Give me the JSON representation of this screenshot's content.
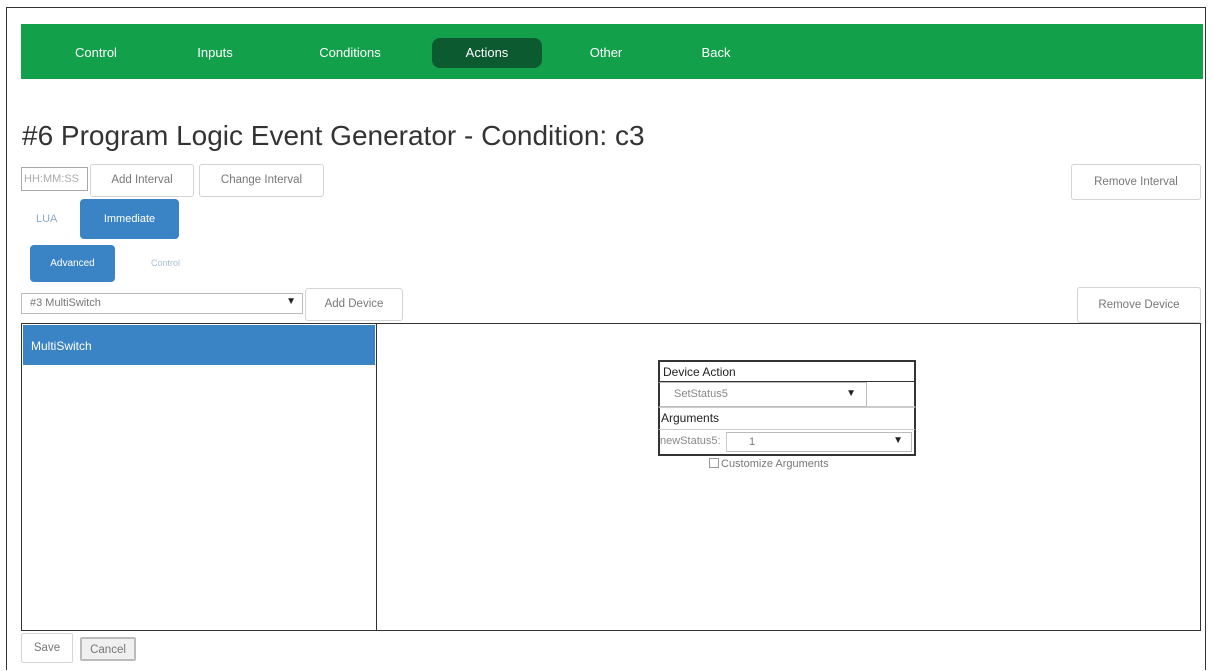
{
  "nav": {
    "items": [
      {
        "label": "Control"
      },
      {
        "label": "Inputs"
      },
      {
        "label": "Conditions"
      },
      {
        "label": "Actions"
      },
      {
        "label": "Other"
      },
      {
        "label": "Back"
      }
    ],
    "active": "Actions",
    "color": "#13a04b",
    "active_color": "#0b5a30"
  },
  "page": {
    "title": "#6 Program Logic Event Generator - Condition: c3"
  },
  "interval": {
    "input_placeholder": "HH:MM:SS",
    "add_label": "Add Interval",
    "change_label": "Change Interval",
    "remove_label": "Remove Interval"
  },
  "mode_tabs": {
    "lua": "LUA",
    "immediate": "Immediate",
    "selected": "Immediate"
  },
  "sub_tabs": {
    "advanced": "Advanced",
    "control": "Control",
    "selected": "Advanced"
  },
  "device": {
    "select_value": "#3 MultiSwitch",
    "add_label": "Add Device",
    "remove_label": "Remove Device",
    "list": [
      "MultiSwitch"
    ],
    "accent": "#3a83c5"
  },
  "action": {
    "header": "Device Action",
    "selected_action": "SetStatus5",
    "arguments_header": "Arguments",
    "arg_name": "newStatus5:",
    "arg_value": "1",
    "customize_label": "Customize Arguments"
  },
  "footer": {
    "save_label": "Save",
    "cancel_label": "Cancel"
  }
}
